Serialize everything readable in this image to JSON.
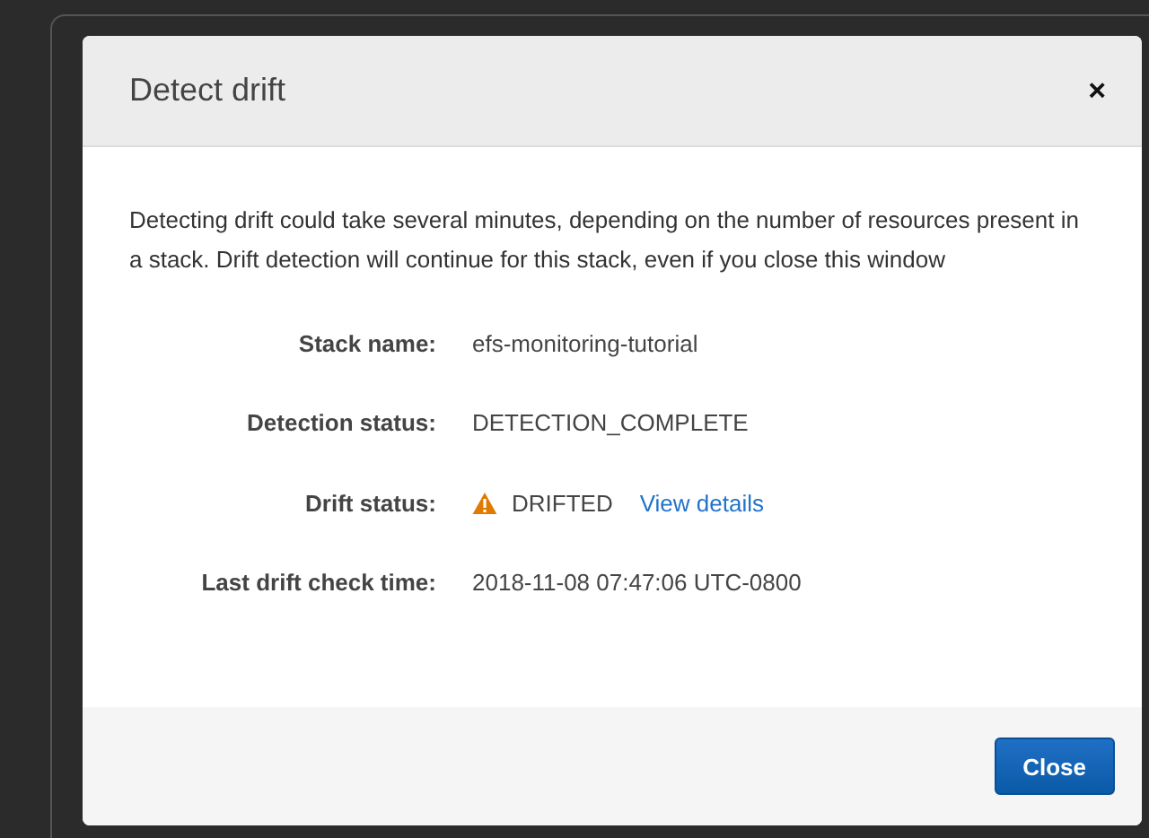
{
  "dialog": {
    "title": "Detect drift",
    "close_icon": "×",
    "message": "Detecting drift could take several minutes, depending on the number of resources present in a stack. Drift detection will continue for this stack, even if you close this window",
    "fields": [
      {
        "kind": "text",
        "label": "Stack name:",
        "value": "efs-monitoring-tutorial"
      },
      {
        "kind": "text",
        "label": "Detection status:",
        "value": "DETECTION_COMPLETE"
      },
      {
        "kind": "warning",
        "label": "Drift status:",
        "value": "DRIFTED",
        "link": "View details"
      },
      {
        "kind": "text",
        "label": "Last drift check time:",
        "value": "2018-11-08 07:47:06 UTC-0800"
      }
    ],
    "buttons": [
      "Close"
    ]
  }
}
